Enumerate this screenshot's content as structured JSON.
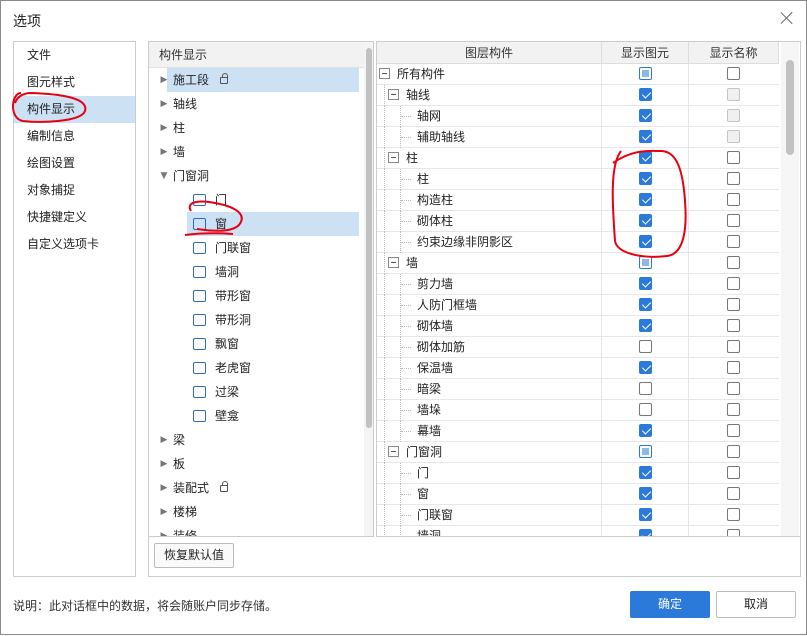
{
  "window": {
    "title": "选项"
  },
  "sidebar": {
    "items": [
      {
        "label": "文件"
      },
      {
        "label": "图元样式"
      },
      {
        "label": "构件显示",
        "active": true
      },
      {
        "label": "编制信息"
      },
      {
        "label": "绘图设置"
      },
      {
        "label": "对象捕捉"
      },
      {
        "label": "快捷键定义"
      },
      {
        "label": "自定义选项卡"
      }
    ]
  },
  "component_tree": {
    "header": "构件显示",
    "items": [
      {
        "label": "施工段",
        "locked": true,
        "expanded": false,
        "selected": true
      },
      {
        "label": "轴线",
        "expanded": false
      },
      {
        "label": "柱",
        "expanded": false
      },
      {
        "label": "墙",
        "expanded": false
      },
      {
        "label": "门窗洞",
        "expanded": true
      },
      {
        "label": "门",
        "child": true,
        "icon": "door-icon"
      },
      {
        "label": "窗",
        "child": true,
        "icon": "window-icon",
        "selected": true
      },
      {
        "label": "门联窗",
        "child": true,
        "icon": "door-window-icon"
      },
      {
        "label": "墙洞",
        "child": true,
        "icon": "wall-hole-icon"
      },
      {
        "label": "带形窗",
        "child": true,
        "icon": "strip-window-icon"
      },
      {
        "label": "带形洞",
        "child": true,
        "icon": "strip-hole-icon"
      },
      {
        "label": "飘窗",
        "child": true,
        "icon": "bay-window-icon"
      },
      {
        "label": "老虎窗",
        "child": true,
        "icon": "dormer-window-icon"
      },
      {
        "label": "过梁",
        "child": true,
        "icon": "lintel-icon"
      },
      {
        "label": "壁龛",
        "child": true,
        "icon": "niche-icon"
      },
      {
        "label": "梁",
        "expanded": false
      },
      {
        "label": "板",
        "expanded": false
      },
      {
        "label": "装配式",
        "locked": true,
        "expanded": false
      },
      {
        "label": "楼梯",
        "expanded": false
      },
      {
        "label": "装修",
        "expanded": false
      }
    ]
  },
  "layer_table": {
    "columns": [
      "图层构件",
      "显示图元",
      "显示名称"
    ],
    "rows": [
      {
        "label": "所有构件",
        "level": 0,
        "group": true,
        "show_element": "partial",
        "show_name": "unchecked"
      },
      {
        "label": "轴线",
        "level": 1,
        "group": true,
        "show_element": "checked",
        "show_name": "disabled"
      },
      {
        "label": "轴网",
        "level": 2,
        "show_element": "checked",
        "show_name": "disabled"
      },
      {
        "label": "辅助轴线",
        "level": 2,
        "show_element": "checked",
        "show_name": "disabled"
      },
      {
        "label": "柱",
        "level": 1,
        "group": true,
        "show_element": "checked",
        "show_name": "unchecked"
      },
      {
        "label": "柱",
        "level": 2,
        "show_element": "checked",
        "show_name": "unchecked"
      },
      {
        "label": "构造柱",
        "level": 2,
        "show_element": "checked",
        "show_name": "unchecked"
      },
      {
        "label": "砌体柱",
        "level": 2,
        "show_element": "checked",
        "show_name": "unchecked"
      },
      {
        "label": "约束边缘非阴影区",
        "level": 2,
        "show_element": "checked",
        "show_name": "unchecked"
      },
      {
        "label": "墙",
        "level": 1,
        "group": true,
        "show_element": "partial",
        "show_name": "unchecked"
      },
      {
        "label": "剪力墙",
        "level": 2,
        "show_element": "checked",
        "show_name": "unchecked"
      },
      {
        "label": "人防门框墙",
        "level": 2,
        "show_element": "checked",
        "show_name": "unchecked"
      },
      {
        "label": "砌体墙",
        "level": 2,
        "show_element": "checked",
        "show_name": "unchecked"
      },
      {
        "label": "砌体加筋",
        "level": 2,
        "show_element": "unchecked",
        "show_name": "unchecked"
      },
      {
        "label": "保温墙",
        "level": 2,
        "show_element": "checked",
        "show_name": "unchecked"
      },
      {
        "label": "暗梁",
        "level": 2,
        "show_element": "unchecked",
        "show_name": "unchecked"
      },
      {
        "label": "墙垛",
        "level": 2,
        "show_element": "unchecked",
        "show_name": "unchecked"
      },
      {
        "label": "幕墙",
        "level": 2,
        "show_element": "checked",
        "show_name": "unchecked"
      },
      {
        "label": "门窗洞",
        "level": 1,
        "group": true,
        "show_element": "partial",
        "show_name": "unchecked"
      },
      {
        "label": "门",
        "level": 2,
        "show_element": "checked",
        "show_name": "unchecked"
      },
      {
        "label": "窗",
        "level": 2,
        "show_element": "checked",
        "show_name": "unchecked"
      },
      {
        "label": "门联窗",
        "level": 2,
        "show_element": "checked",
        "show_name": "unchecked"
      },
      {
        "label": "墙洞",
        "level": 2,
        "show_element": "checked",
        "show_name": "unchecked"
      }
    ]
  },
  "buttons": {
    "reset": "恢复默认值",
    "ok": "确定",
    "cancel": "取消"
  },
  "footer": {
    "note": "说明：此对话框中的数据，将会随账户同步存储。"
  },
  "colors": {
    "accent": "#2b79d8",
    "selection": "#cde1f5",
    "annotation": "#e60012"
  }
}
